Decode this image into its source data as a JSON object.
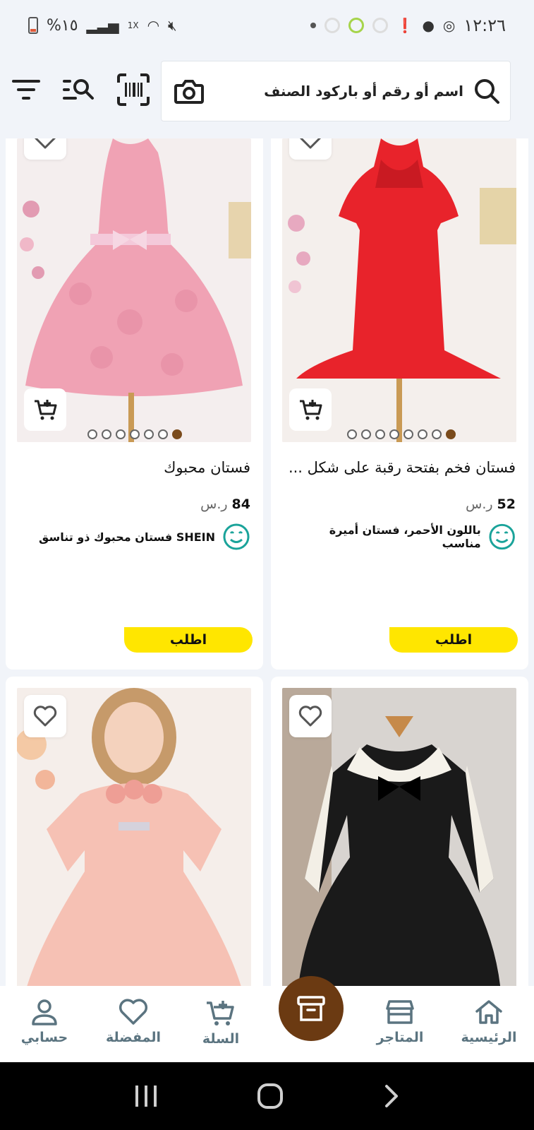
{
  "status_bar": {
    "time": "١٢:٢٦",
    "battery_text": "%١٥",
    "signal_badge": "1X"
  },
  "search": {
    "placeholder": "اسم أو رقم أو باركود الصنف"
  },
  "products": [
    {
      "title": "فستان فخم بفتحة رقبة على شكل ...",
      "price": "52",
      "currency": "ر.س",
      "seller_text": "باللون الأحمر، فستان أميرة مناسب",
      "order_label": "اطلب",
      "image_dots": 8,
      "active_dot": 7,
      "colors": {
        "dress": "#e8232b",
        "bg": "#f2eeec"
      }
    },
    {
      "title": "فستان محبوك",
      "price": "84",
      "currency": "ر.س",
      "seller_text": "SHEIN فستان محبوك ذو تناسق",
      "order_label": "اطلب",
      "image_dots": 7,
      "active_dot": 6,
      "colors": {
        "dress": "#f0a2b4",
        "bg": "#f3ecec"
      }
    },
    {
      "colors": {
        "dress": "#1a1a1a",
        "bg": "#d8d4d0"
      }
    },
    {
      "colors": {
        "dress": "#f6c1b4",
        "bg": "#f5eeea"
      }
    }
  ],
  "bottom_nav": {
    "home": "الرئيسية",
    "stores": "المتاجر",
    "cart": "السلة",
    "favorites": "المفضلة",
    "account": "حسابي"
  },
  "theme": {
    "accent_yellow": "#ffe600",
    "accent_brown": "#6b3a12",
    "nav_gray": "#5b7480",
    "smile_teal": "#1aa39a"
  }
}
